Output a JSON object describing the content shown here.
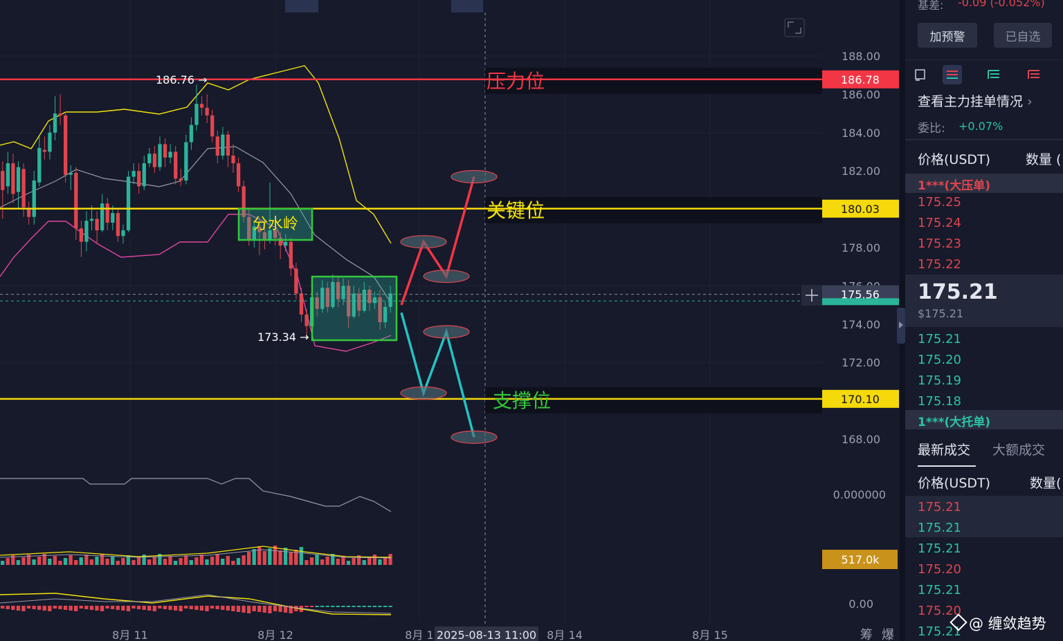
{
  "chart_data": {
    "type": "candlestick",
    "y_axis": {
      "min": 166.0,
      "max": 189.0,
      "ticks": [
        "188.00",
        "186.00",
        "184.00",
        "182.00",
        "180.00",
        "178.00",
        "176.00",
        "174.00",
        "172.00",
        "170.00",
        "168.00"
      ]
    },
    "x_axis": {
      "labels": [
        "8月 11",
        "8月 12",
        "8月 1",
        "8月 14",
        "8月 15"
      ]
    },
    "crosshair_time": "2025-08-13 11:00",
    "price_tags": [
      {
        "value": 186.78,
        "label": "186.78",
        "color": "#f23645"
      },
      {
        "value": 180.03,
        "label": "180.03",
        "color": "#f5d90a"
      },
      {
        "value": 170.1,
        "label": "170.10",
        "color": "#f5d90a"
      },
      {
        "value": 175.56,
        "label": "175.56",
        "color": "#3a4058"
      }
    ],
    "levels": [
      {
        "value": 186.78,
        "label": "压力位",
        "color": "#f23645"
      },
      {
        "value": 180.03,
        "label": "关键位",
        "color": "#f5d90a"
      },
      {
        "value": 170.1,
        "label": "支撑位",
        "color": "#f5d90a"
      }
    ],
    "annotations": [
      {
        "label": "186.76",
        "value": 186.76
      },
      {
        "label": "173.34",
        "value": 173.34
      },
      {
        "label": "分水岭"
      }
    ],
    "bull_path": [
      [
        580,
        175.0
      ],
      [
        612,
        178.3
      ],
      [
        645,
        176.5
      ],
      [
        685,
        181.7
      ]
    ],
    "bear_path": [
      [
        580,
        174.6
      ],
      [
        612,
        170.4
      ],
      [
        645,
        173.6
      ],
      [
        685,
        168.1
      ]
    ],
    "candles": [
      [
        182.0,
        181.0,
        182.5,
        179.5
      ],
      [
        181.2,
        182.4,
        183.0,
        180.8
      ],
      [
        182.4,
        180.8,
        182.9,
        180.3
      ],
      [
        180.9,
        182.2,
        182.5,
        180.0
      ],
      [
        182.1,
        180.1,
        182.4,
        179.6
      ],
      [
        180.0,
        179.6,
        180.4,
        179.2
      ],
      [
        179.6,
        181.5,
        182.0,
        179.2
      ],
      [
        181.4,
        183.2,
        183.8,
        181.2
      ],
      [
        183.1,
        183.0,
        183.8,
        182.6
      ],
      [
        183.0,
        184.0,
        184.4,
        182.6
      ],
      [
        184.0,
        185.0,
        185.9,
        183.6
      ],
      [
        185.0,
        184.9,
        186.0,
        184.4
      ],
      [
        184.9,
        181.8,
        185.1,
        181.4
      ],
      [
        181.8,
        181.9,
        182.3,
        181.0
      ],
      [
        181.9,
        179.0,
        182.2,
        178.4
      ],
      [
        179.0,
        178.3,
        179.4,
        177.5
      ],
      [
        178.3,
        179.4,
        179.9,
        177.8
      ],
      [
        179.4,
        179.5,
        180.2,
        178.9
      ],
      [
        179.5,
        178.9,
        179.9,
        178.2
      ],
      [
        178.9,
        180.3,
        180.8,
        178.8
      ],
      [
        180.3,
        179.3,
        180.6,
        178.9
      ],
      [
        179.3,
        179.8,
        180.2,
        178.9
      ],
      [
        179.8,
        178.6,
        180.0,
        178.3
      ],
      [
        178.6,
        178.9,
        179.2,
        178.2
      ],
      [
        178.9,
        181.7,
        182.0,
        178.8
      ],
      [
        181.7,
        182.0,
        182.4,
        181.3
      ],
      [
        182.0,
        181.2,
        182.4,
        180.8
      ],
      [
        181.2,
        182.4,
        182.8,
        181.0
      ],
      [
        182.4,
        182.9,
        183.2,
        182.2
      ],
      [
        182.9,
        182.2,
        183.3,
        181.9
      ],
      [
        182.2,
        183.4,
        183.8,
        182.0
      ],
      [
        183.4,
        182.7,
        183.7,
        182.2
      ],
      [
        182.7,
        183.0,
        183.4,
        182.4
      ],
      [
        183.0,
        181.6,
        183.3,
        181.3
      ],
      [
        181.6,
        181.5,
        182.1,
        181.2
      ],
      [
        181.5,
        183.5,
        183.9,
        181.3
      ],
      [
        183.5,
        184.4,
        184.8,
        183.1
      ],
      [
        184.4,
        185.5,
        186.5,
        184.1
      ],
      [
        185.5,
        185.3,
        185.9,
        184.9
      ],
      [
        185.3,
        184.9,
        186.0,
        184.5
      ],
      [
        184.9,
        183.8,
        185.2,
        183.5
      ],
      [
        183.8,
        182.8,
        184.1,
        182.4
      ],
      [
        182.8,
        183.9,
        184.3,
        182.6
      ],
      [
        183.9,
        182.8,
        184.1,
        182.2
      ],
      [
        182.8,
        182.4,
        183.4,
        181.9
      ],
      [
        182.4,
        181.2,
        182.7,
        180.9
      ],
      [
        181.2,
        179.6,
        181.5,
        179.3
      ],
      [
        179.6,
        178.4,
        180.0,
        178.1
      ],
      [
        178.4,
        179.1,
        179.4,
        178.0
      ],
      [
        179.1,
        178.8,
        179.6,
        177.6
      ],
      [
        178.8,
        178.4,
        179.2,
        177.9
      ],
      [
        178.4,
        178.9,
        181.4,
        178.2
      ],
      [
        178.9,
        178.5,
        179.3,
        178.1
      ],
      [
        178.5,
        178.1,
        178.8,
        177.4
      ],
      [
        178.1,
        178.3,
        178.7,
        177.8
      ],
      [
        178.3,
        176.9,
        178.5,
        176.5
      ],
      [
        176.9,
        175.6,
        177.2,
        175.3
      ],
      [
        175.6,
        174.5,
        175.9,
        174.1
      ],
      [
        174.5,
        173.9,
        174.8,
        173.3
      ],
      [
        173.9,
        175.4,
        175.8,
        173.6
      ],
      [
        175.4,
        174.8,
        175.7,
        174.4
      ],
      [
        174.8,
        175.9,
        176.3,
        174.6
      ],
      [
        175.9,
        174.9,
        176.2,
        174.6
      ],
      [
        174.9,
        176.2,
        176.6,
        174.8
      ],
      [
        176.2,
        175.3,
        176.5,
        174.9
      ],
      [
        175.3,
        176.0,
        176.4,
        175.0
      ],
      [
        176.0,
        174.4,
        176.3,
        173.8
      ],
      [
        174.4,
        175.6,
        176.0,
        174.3
      ],
      [
        175.6,
        174.7,
        175.9,
        174.4
      ],
      [
        174.7,
        175.8,
        176.2,
        174.6
      ],
      [
        175.8,
        175.1,
        176.0,
        174.7
      ],
      [
        175.1,
        175.4,
        175.7,
        174.8
      ],
      [
        175.4,
        174.1,
        175.8,
        173.7
      ],
      [
        174.1,
        174.9,
        175.2,
        173.8
      ],
      [
        174.9,
        175.6,
        176.0,
        174.6
      ]
    ],
    "volume_label": "517.0k",
    "osc_label": "0.000000",
    "macd_label": "0.00"
  },
  "sidebar": {
    "basis_label": "基差:",
    "basis_value": "-0.09 (-0.052%)",
    "btn_alert": "加预警",
    "btn_watch": "已自选",
    "orders_title": "查看主力挂单情况",
    "ratio_label": "委比:",
    "ratio_value": "+0.07%",
    "col_price": "价格(USDT)",
    "col_qty": "数量 (",
    "big_ask": "1***(大压单)",
    "asks": [
      "175.25",
      "175.24",
      "175.23",
      "175.22"
    ],
    "last_price": "175.21",
    "last_price_usd": "$175.21",
    "bids": [
      "175.21",
      "175.20",
      "175.19",
      "175.18"
    ],
    "big_bid": "1***(大托单)",
    "tab_latest": "最新成交",
    "tab_large": "大额成交",
    "col_price2": "价格(USDT)",
    "col_qty2": "数量(",
    "trades": [
      {
        "p": "175.21",
        "side": "ask"
      },
      {
        "p": "175.21",
        "side": "bid"
      },
      {
        "p": "175.21",
        "side": "bid"
      },
      {
        "p": "175.20",
        "side": "ask"
      },
      {
        "p": "175.21",
        "side": "bid"
      },
      {
        "p": "175.20",
        "side": "ask"
      },
      {
        "p": "175.21",
        "side": "bid"
      }
    ]
  },
  "watermark": "@ 缠敛趋势",
  "bottom_right": [
    "筹",
    "爆"
  ]
}
